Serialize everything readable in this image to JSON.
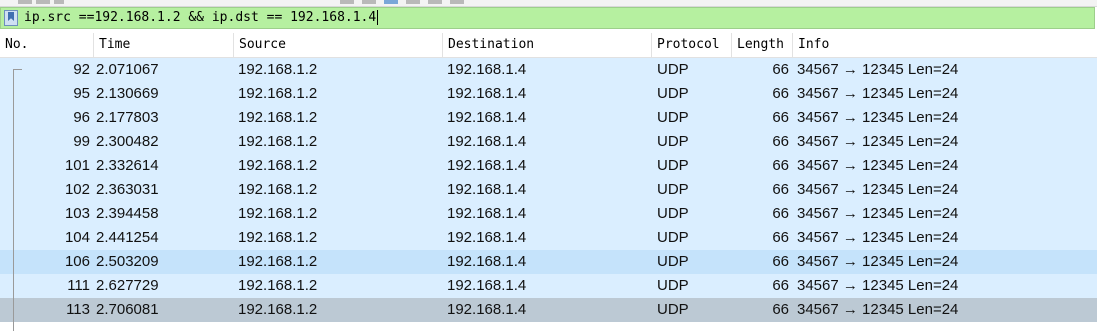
{
  "filter": {
    "text": "ip.src ==192.168.1.2 && ip.dst == 192.168.1.4",
    "background": "#b6f0a0"
  },
  "columns": [
    "No.",
    "Time",
    "Source",
    "Destination",
    "Protocol",
    "Length",
    "Info"
  ],
  "packets": [
    {
      "no": "92",
      "time": "2.071067",
      "source": "192.168.1.2",
      "destination": "192.168.1.4",
      "protocol": "UDP",
      "length": "66",
      "info": "34567 → 12345 Len=24"
    },
    {
      "no": "95",
      "time": "2.130669",
      "source": "192.168.1.2",
      "destination": "192.168.1.4",
      "protocol": "UDP",
      "length": "66",
      "info": "34567 → 12345 Len=24"
    },
    {
      "no": "96",
      "time": "2.177803",
      "source": "192.168.1.2",
      "destination": "192.168.1.4",
      "protocol": "UDP",
      "length": "66",
      "info": "34567 → 12345 Len=24"
    },
    {
      "no": "99",
      "time": "2.300482",
      "source": "192.168.1.2",
      "destination": "192.168.1.4",
      "protocol": "UDP",
      "length": "66",
      "info": "34567 → 12345 Len=24"
    },
    {
      "no": "101",
      "time": "2.332614",
      "source": "192.168.1.2",
      "destination": "192.168.1.4",
      "protocol": "UDP",
      "length": "66",
      "info": "34567 → 12345 Len=24"
    },
    {
      "no": "102",
      "time": "2.363031",
      "source": "192.168.1.2",
      "destination": "192.168.1.4",
      "protocol": "UDP",
      "length": "66",
      "info": "34567 → 12345 Len=24"
    },
    {
      "no": "103",
      "time": "2.394458",
      "source": "192.168.1.2",
      "destination": "192.168.1.4",
      "protocol": "UDP",
      "length": "66",
      "info": "34567 → 12345 Len=24"
    },
    {
      "no": "104",
      "time": "2.441254",
      "source": "192.168.1.2",
      "destination": "192.168.1.4",
      "protocol": "UDP",
      "length": "66",
      "info": "34567 → 12345 Len=24"
    },
    {
      "no": "106",
      "time": "2.503209",
      "source": "192.168.1.2",
      "destination": "192.168.1.4",
      "protocol": "UDP",
      "length": "66",
      "info": "34567 → 12345 Len=24"
    },
    {
      "no": "111",
      "time": "2.627729",
      "source": "192.168.1.2",
      "destination": "192.168.1.4",
      "protocol": "UDP",
      "length": "66",
      "info": "34567 → 12345 Len=24"
    },
    {
      "no": "113",
      "time": "2.706081",
      "source": "192.168.1.2",
      "destination": "192.168.1.4",
      "protocol": "UDP",
      "length": "66",
      "info": "34567 → 12345 Len=24"
    }
  ],
  "row_colors": {
    "default": "#daeeff",
    "highlight": "#c5e3fb",
    "selected": "#bcc9d4"
  }
}
